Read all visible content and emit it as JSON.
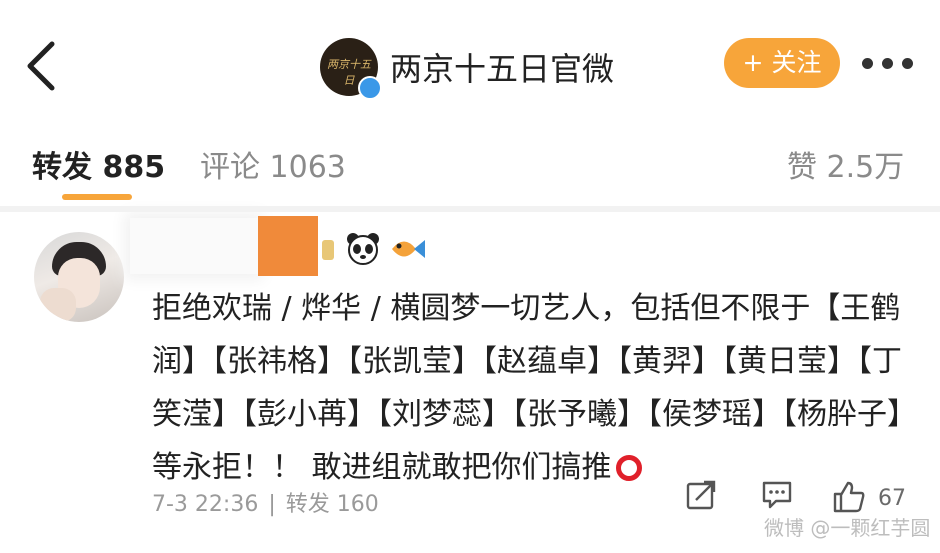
{
  "header": {
    "back_icon": "chevron-left-icon",
    "account_logo_text": "两京十五日",
    "account_name": "两京十五日官微",
    "follow_label": "+ 关注",
    "more_icon": "more-icon"
  },
  "tabs": {
    "repost": "转发 885",
    "comment": "评论 1063",
    "like": "赞 2.5万"
  },
  "comment": {
    "text": "拒绝欢瑞 / 烨华 / 横圆梦一切艺人，包括但不限于【王鹤润】【张祎格】【张凯莹】【赵蕴卓】【黄羿】【黄日莹】【丁笑滢】【彭小苒】【刘梦蕊】【张予曦】【侯梦瑶】【杨肸子】等永拒！！ 敢进组就敢把你们搞推",
    "time": "7-3 22:36",
    "separator": "|",
    "repost_count": "转发 160",
    "like_count": "67",
    "watermark": "微博 @一颗红芋圆"
  },
  "colors": {
    "accent": "#f7a53a",
    "mask": "#f08a3a",
    "verified": "#3a98e8"
  }
}
